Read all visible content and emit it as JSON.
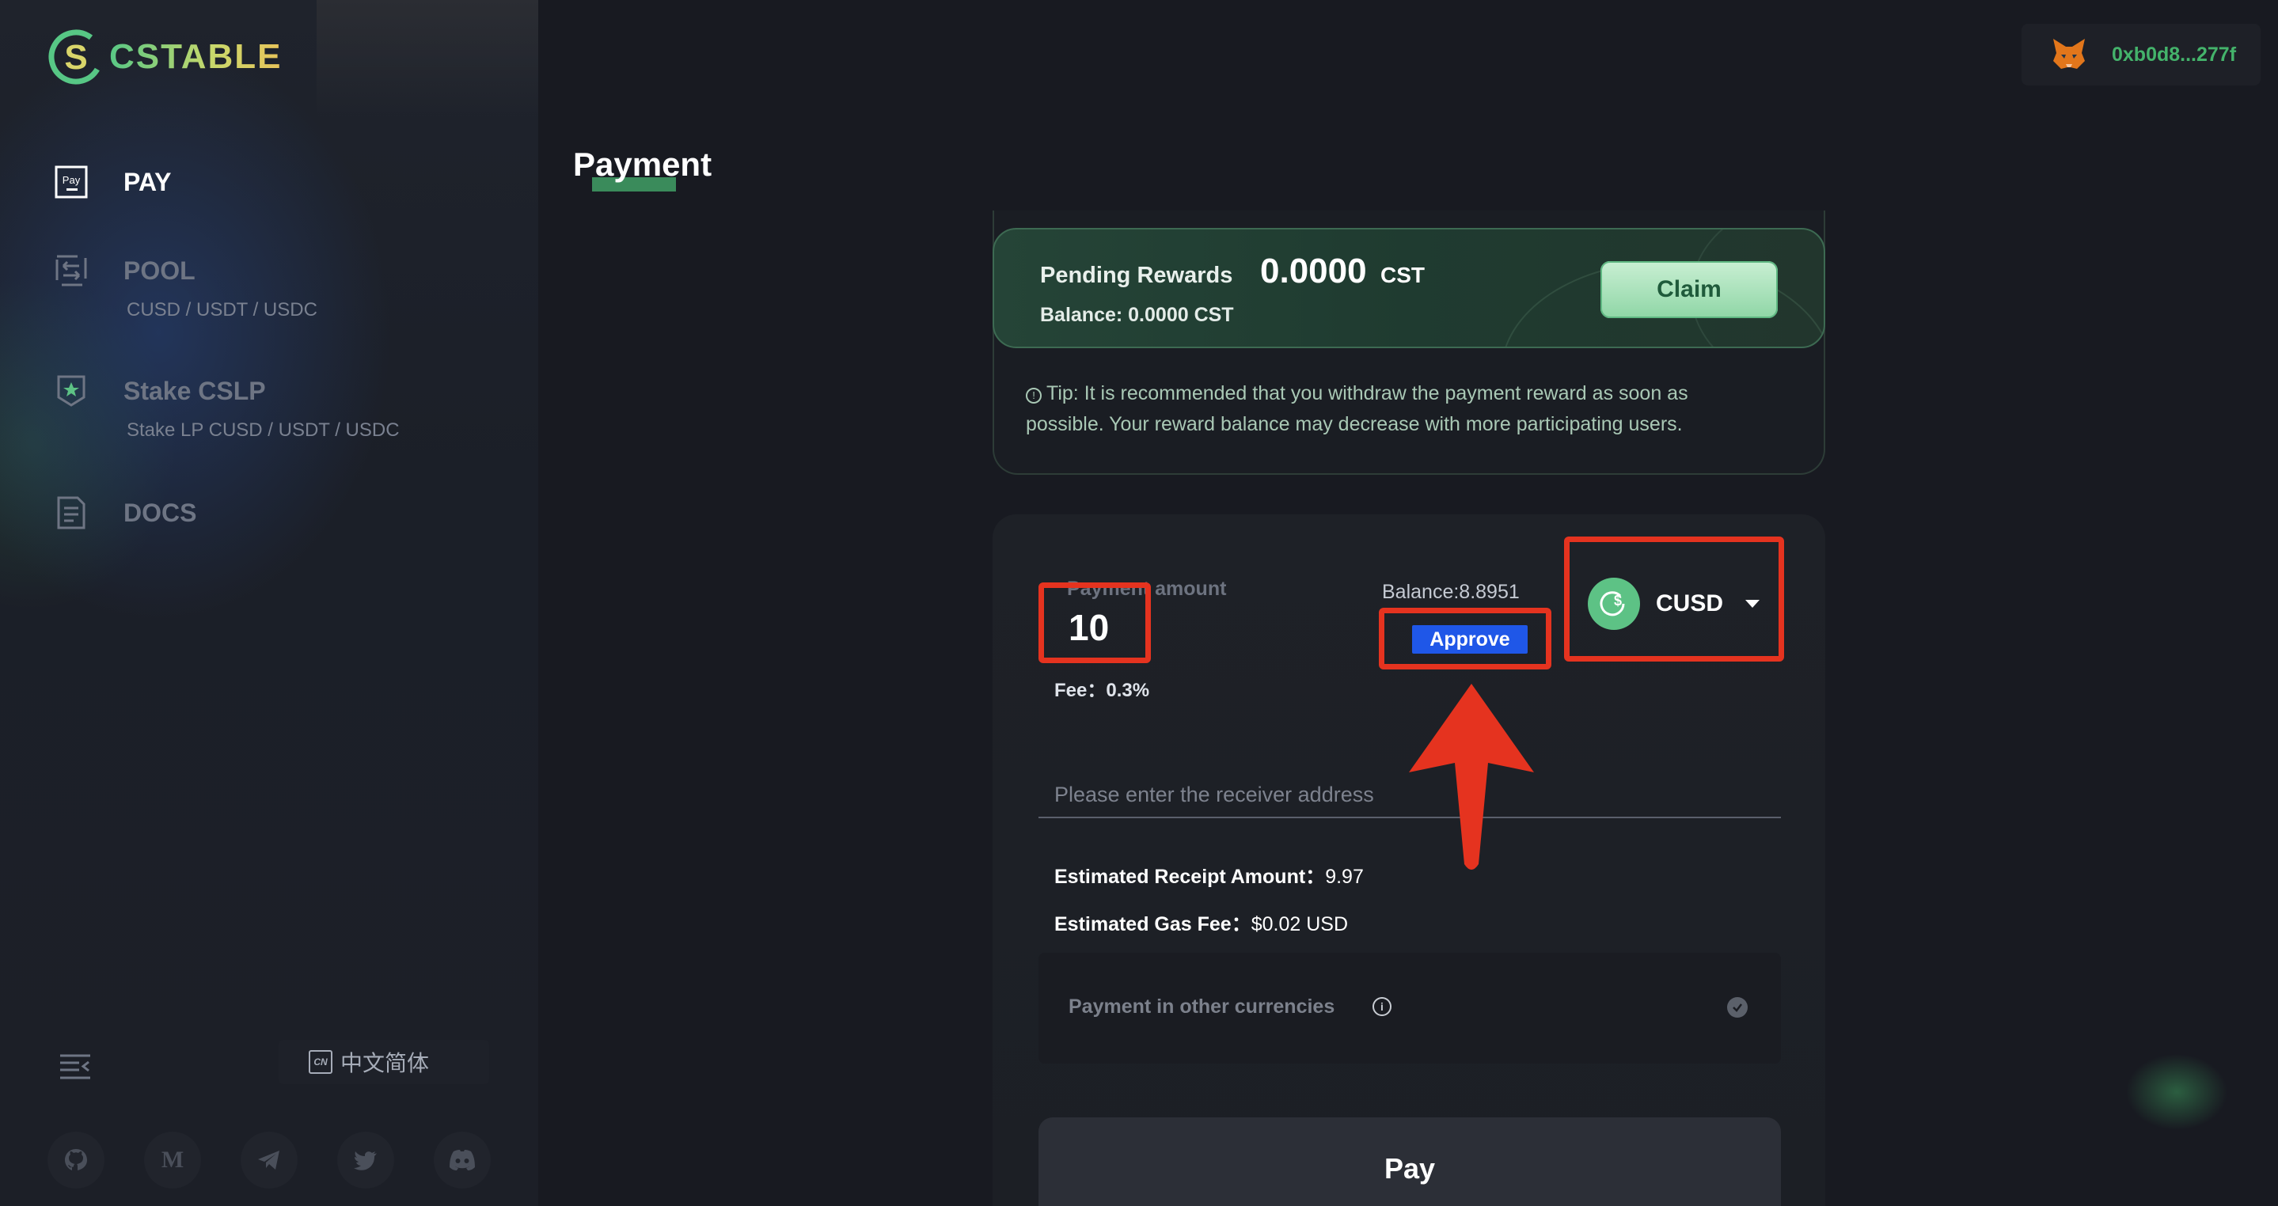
{
  "brand": {
    "logo_text": "CSTABLE"
  },
  "sidebar": {
    "items": [
      {
        "label": "PAY",
        "sub": "",
        "active": true,
        "icon": "pay-icon"
      },
      {
        "label": "POOL",
        "sub": "CUSD / USDT / USDC",
        "active": false,
        "icon": "pool-swap-icon"
      },
      {
        "label": "Stake CSLP",
        "sub": "Stake LP CUSD / USDT / USDC",
        "active": false,
        "icon": "stake-badge-icon"
      },
      {
        "label": "DOCS",
        "sub": "",
        "active": false,
        "icon": "docs-icon"
      }
    ],
    "language_label": "中文简体",
    "language_icon_text": "CN",
    "socials": [
      "github-icon",
      "medium-icon",
      "telegram-icon",
      "twitter-icon",
      "discord-icon"
    ],
    "medium_letter": "M"
  },
  "header": {
    "wallet_address": "0xb0d8...277f",
    "wallet_icon": "metamask-fox-icon"
  },
  "page": {
    "title": "Payment"
  },
  "rewards": {
    "pending_label": "Pending Rewards",
    "pending_value": "0.0000",
    "pending_unit": "CST",
    "balance_text": "Balance: 0.0000 CST",
    "claim_label": "Claim",
    "tip_text": "Tip: It is recommended that you withdraw the payment reward as soon as possible. Your reward balance may decrease with more participating users."
  },
  "payment": {
    "amount_label": "Payment amount",
    "amount_value": "10",
    "fee_text": "Fee：0.3%",
    "balance_text": "Balance:8.8951",
    "approve_label": "Approve",
    "token": "CUSD",
    "receiver_placeholder": "Please enter the receiver address",
    "receipt_label": "Estimated Receipt Amount：",
    "receipt_value": "9.97",
    "gas_label": "Estimated Gas Fee：",
    "gas_value": "$0.02 USD",
    "other_currency_label": "Payment in other currencies",
    "pay_label": "Pay"
  },
  "colors": {
    "accent_green": "#44b36b",
    "approve_blue": "#1f57e8",
    "annotation_red": "#e5331f",
    "background": "#181a21"
  }
}
